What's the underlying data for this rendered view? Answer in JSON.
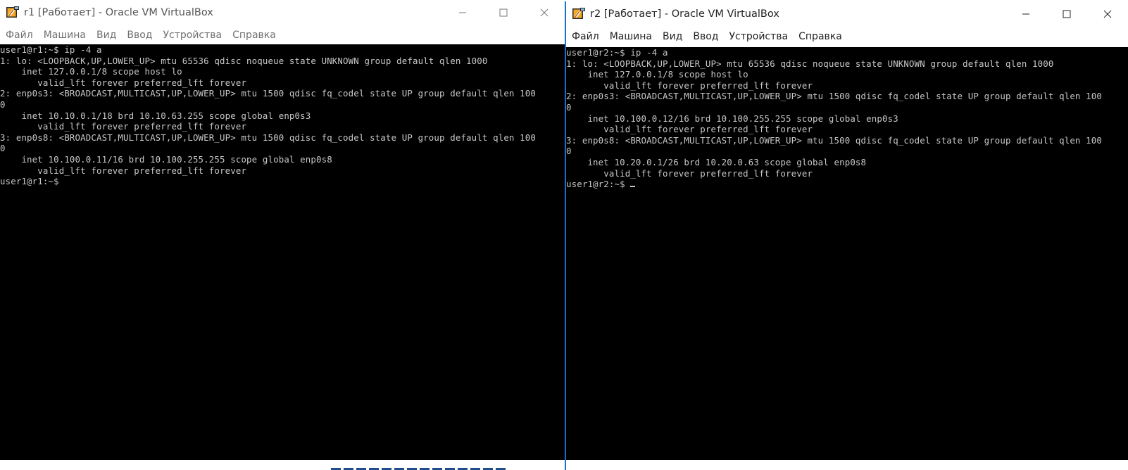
{
  "windows": [
    {
      "title": "r1 [Работает] - Oracle VM VirtualBox",
      "active": false,
      "menu": [
        "Файл",
        "Машина",
        "Вид",
        "Ввод",
        "Устройства",
        "Справка"
      ],
      "terminal_lines": [
        "user1@r1:~$ ip -4 a",
        "1: lo: <LOOPBACK,UP,LOWER_UP> mtu 65536 qdisc noqueue state UNKNOWN group default qlen 1000",
        "    inet 127.0.0.1/8 scope host lo",
        "       valid_lft forever preferred_lft forever",
        "2: enp0s3: <BROADCAST,MULTICAST,UP,LOWER_UP> mtu 1500 qdisc fq_codel state UP group default qlen 100",
        "0",
        "    inet 10.10.0.1/18 brd 10.10.63.255 scope global enp0s3",
        "       valid_lft forever preferred_lft forever",
        "3: enp0s8: <BROADCAST,MULTICAST,UP,LOWER_UP> mtu 1500 qdisc fq_codel state UP group default qlen 100",
        "0",
        "    inet 10.100.0.11/16 brd 10.100.255.255 scope global enp0s8",
        "       valid_lft forever preferred_lft forever",
        "user1@r1:~$"
      ]
    },
    {
      "title": "r2 [Работает] - Oracle VM VirtualBox",
      "active": true,
      "menu": [
        "Файл",
        "Машина",
        "Вид",
        "Ввод",
        "Устройства",
        "Справка"
      ],
      "terminal_lines": [
        "user1@r2:~$ ip -4 a",
        "1: lo: <LOOPBACK,UP,LOWER_UP> mtu 65536 qdisc noqueue state UNKNOWN group default qlen 1000",
        "    inet 127.0.0.1/8 scope host lo",
        "       valid_lft forever preferred_lft forever",
        "2: enp0s3: <BROADCAST,MULTICAST,UP,LOWER_UP> mtu 1500 qdisc fq_codel state UP group default qlen 100",
        "0",
        "    inet 10.100.0.12/16 brd 10.100.255.255 scope global enp0s3",
        "       valid_lft forever preferred_lft forever",
        "3: enp0s8: <BROADCAST,MULTICAST,UP,LOWER_UP> mtu 1500 qdisc fq_codel state UP group default qlen 100",
        "0",
        "    inet 10.20.0.1/26 brd 10.20.0.63 scope global enp0s8",
        "       valid_lft forever preferred_lft forever",
        "user1@r2:~$ "
      ]
    }
  ],
  "icons": {
    "app": "virtualbox-icon",
    "minimize": "minimize-icon",
    "maximize": "maximize-icon",
    "close": "close-icon"
  },
  "colors": {
    "terminal_bg": "#000000",
    "terminal_fg": "#c8c8c8",
    "active_border": "#1a6fd0"
  }
}
